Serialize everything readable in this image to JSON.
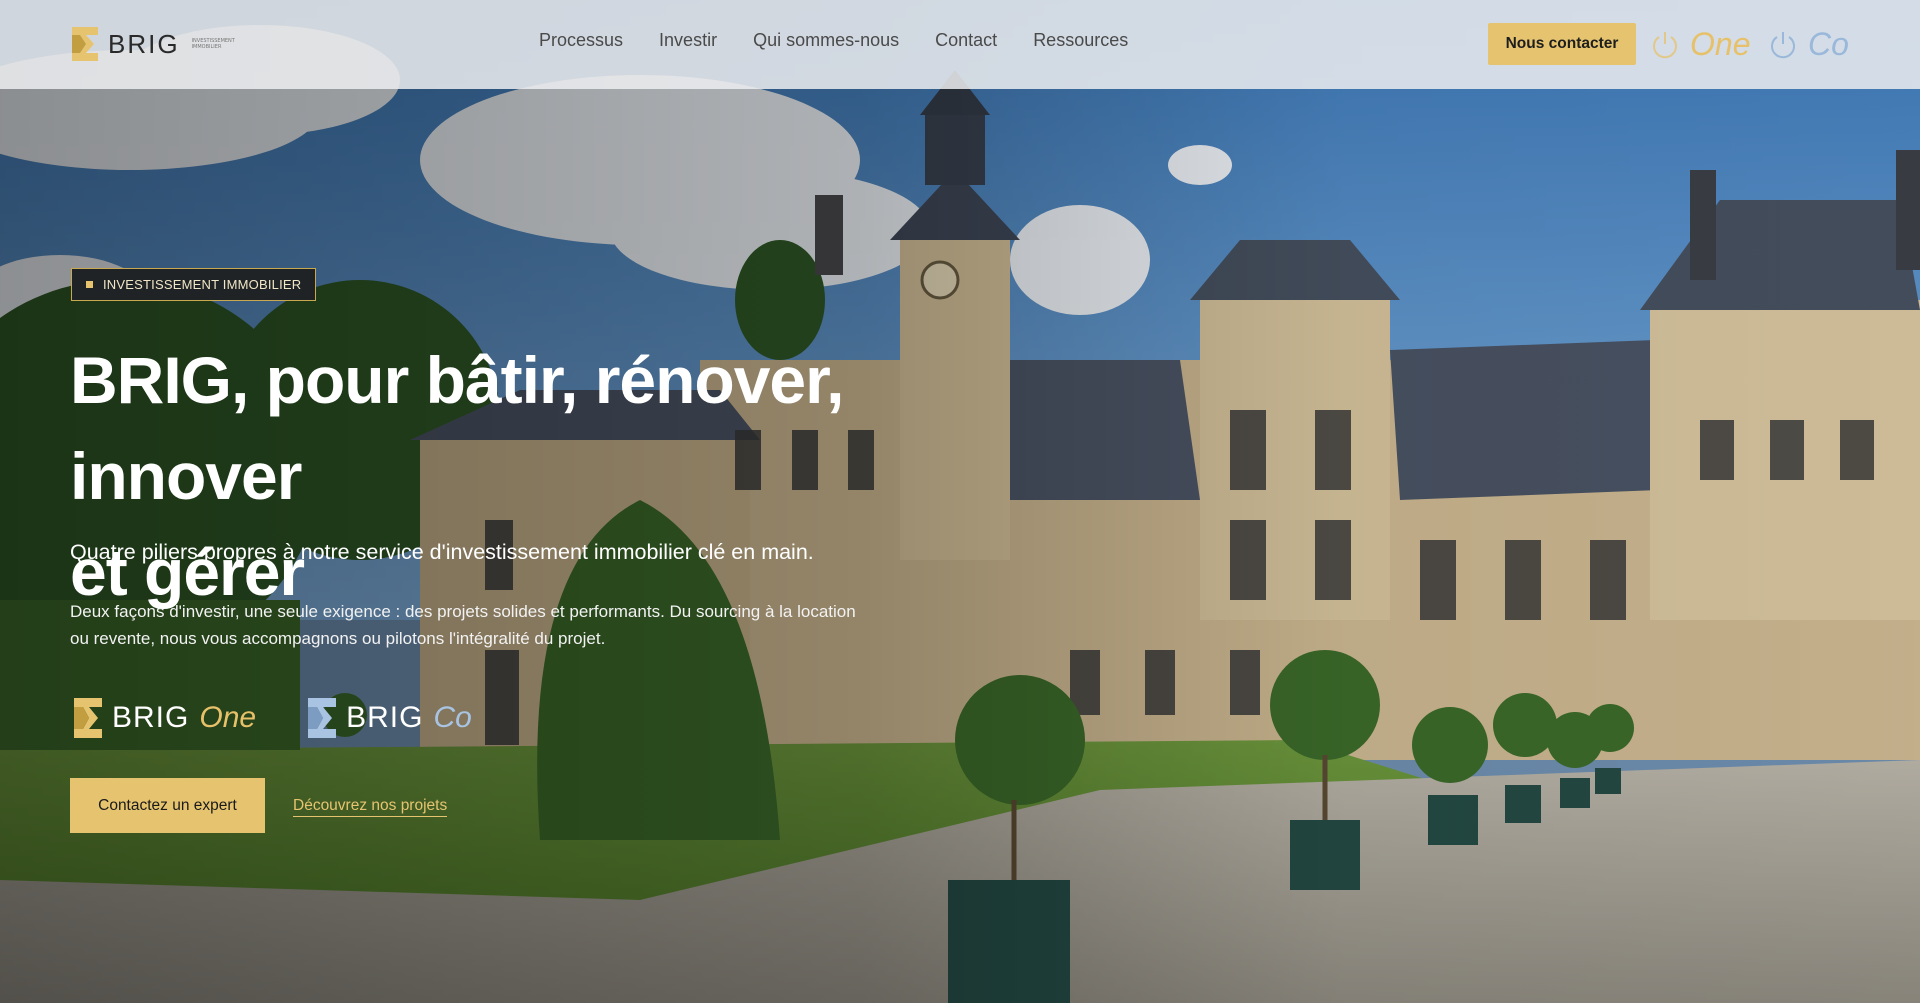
{
  "header": {
    "logo_text": "BRIG",
    "logo_sub": "INVESTISSEMENT IMMOBILIER",
    "nav": [
      {
        "label": "Processus"
      },
      {
        "label": "Investir"
      },
      {
        "label": "Qui sommes-nous"
      },
      {
        "label": "Contact"
      },
      {
        "label": "Ressources"
      }
    ],
    "contact_button": "Nous contacter",
    "toggle_one": "One",
    "toggle_co": "Co"
  },
  "hero": {
    "badge": "INVESTISSEMENT IMMOBILIER",
    "title_line1": "BRIG, pour bâtir, rénover, innover",
    "title_line2": "et gérer",
    "subtitle": "Quatre piliers propres à notre service d'investissement immobilier clé en main.",
    "description_line1": "Deux façons d'investir, une seule exigence : des projets solides et performants. Du sourcing à la location",
    "description_line2": "ou revente, nous vous accompagnons ou pilotons l'intégralité du projet.",
    "brands": [
      {
        "name": "BRIG",
        "suffix": "One"
      },
      {
        "name": "BRIG",
        "suffix": "Co"
      }
    ],
    "cta_primary": "Contactez un expert",
    "cta_secondary": "Découvrez nos projets"
  },
  "colors": {
    "gold": "#e6c46f",
    "blue_accent": "#9ab8da",
    "dark_badge": "#1f2326"
  },
  "icons": [
    "brig-logo-mark",
    "power-icon",
    "brig-one-mark",
    "brig-co-mark"
  ]
}
